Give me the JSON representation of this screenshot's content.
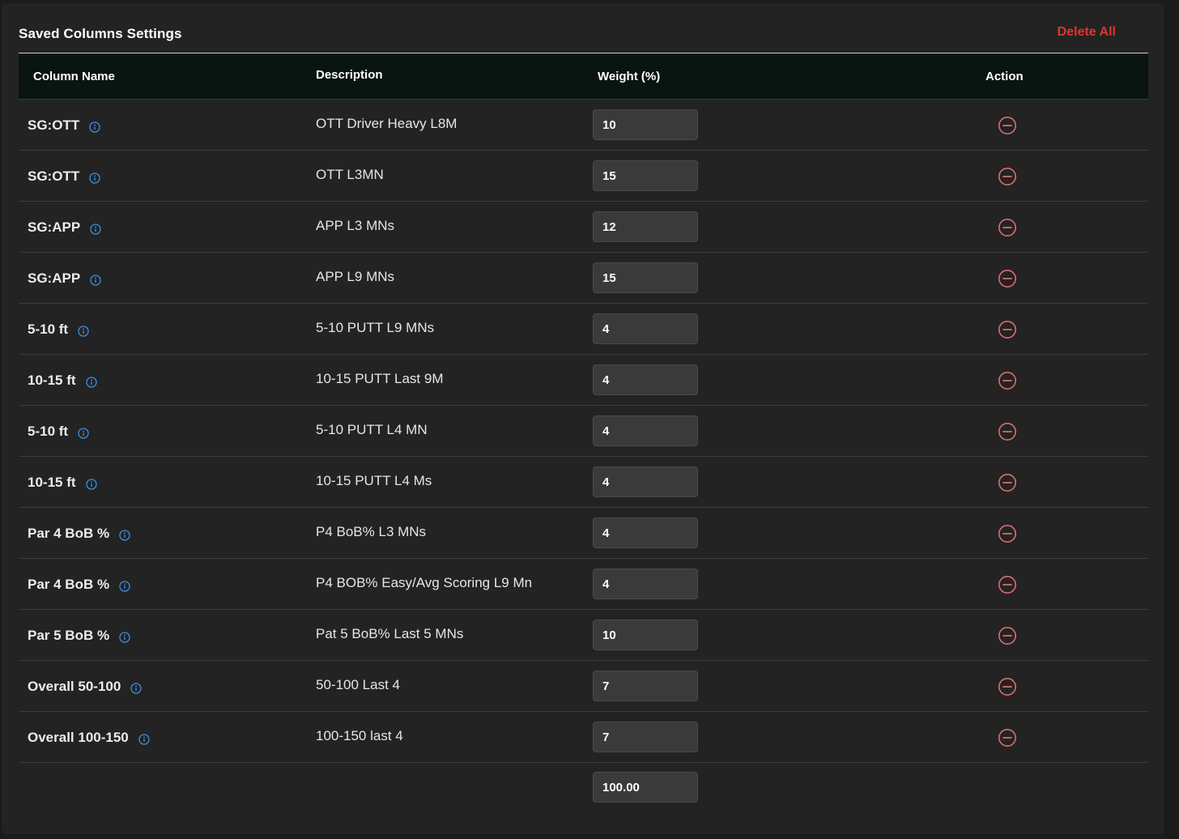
{
  "header": {
    "title": "Saved Columns Settings",
    "delete_all_label": "Delete All"
  },
  "table": {
    "columns": [
      "Column Name",
      "Description",
      "Weight (%)",
      "Action"
    ],
    "rows": [
      {
        "name": "SG:OTT",
        "description": "OTT Driver Heavy L8M",
        "weight": "10"
      },
      {
        "name": "SG:OTT",
        "description": "OTT L3MN",
        "weight": "15"
      },
      {
        "name": "SG:APP",
        "description": "APP L3 MNs",
        "weight": "12"
      },
      {
        "name": "SG:APP",
        "description": "APP L9 MNs",
        "weight": "15"
      },
      {
        "name": "5-10 ft",
        "description": "5-10 PUTT L9 MNs",
        "weight": "4"
      },
      {
        "name": "10-15 ft",
        "description": "10-15 PUTT Last 9M",
        "weight": "4"
      },
      {
        "name": "5-10 ft",
        "description": "5-10 PUTT L4 MN",
        "weight": "4"
      },
      {
        "name": "10-15 ft",
        "description": "10-15 PUTT L4 Ms",
        "weight": "4"
      },
      {
        "name": "Par 4 BoB %",
        "description": "P4 BoB% L3 MNs",
        "weight": "4"
      },
      {
        "name": "Par 4 BoB %",
        "description": "P4 BOB% Easy/Avg Scoring L9 Mn",
        "weight": "4"
      },
      {
        "name": "Par 5 BoB %",
        "description": "Pat 5 BoB% Last 5 MNs",
        "weight": "10"
      },
      {
        "name": "Overall 50-100",
        "description": "50-100 Last 4",
        "weight": "7"
      },
      {
        "name": "Overall 100-150",
        "description": "100-150 last 4",
        "weight": "7"
      }
    ],
    "total_weight": "100.00"
  },
  "icons": {
    "info": "info-circle-icon",
    "remove": "minus-circle-icon"
  },
  "colors": {
    "background": "#232323",
    "header_row": "#081510",
    "accent_red": "#e2342f",
    "remove_icon": "#e06c6c",
    "info_icon": "#3b8fe0",
    "input_bg": "#3a3a3a"
  }
}
